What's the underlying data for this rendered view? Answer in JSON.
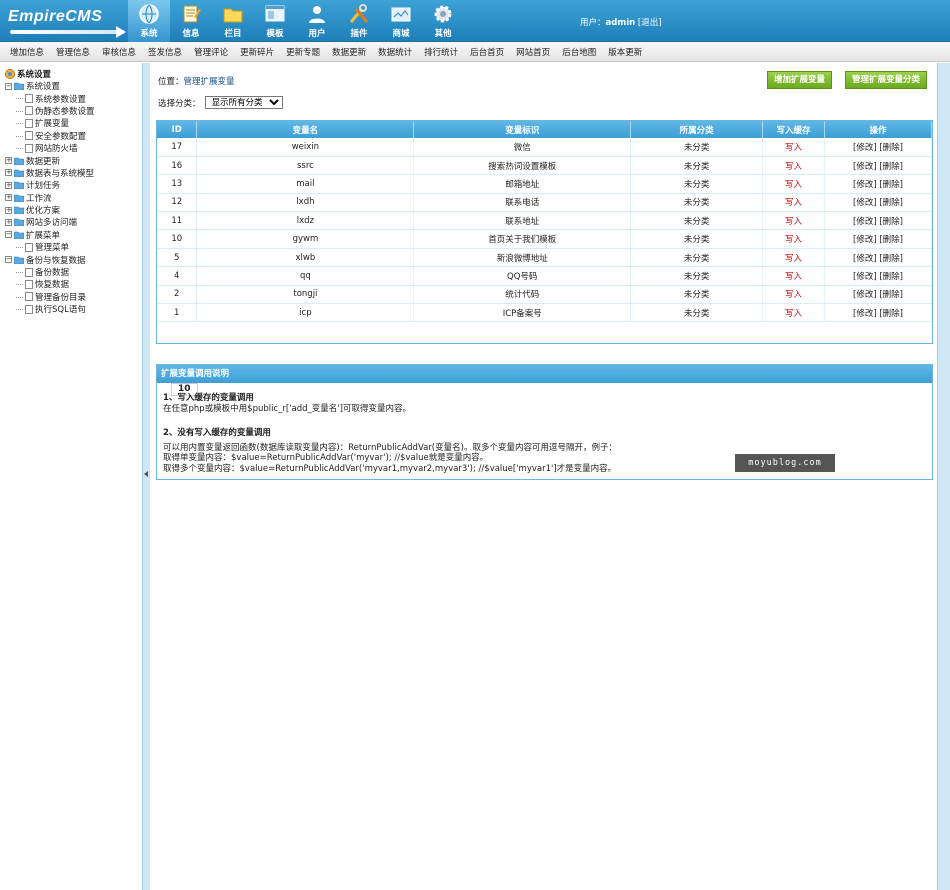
{
  "header": {
    "logo_text": "EmpireCMS",
    "modules": [
      {
        "label": "系统",
        "icon": "globe-icon",
        "active": true
      },
      {
        "label": "信息",
        "icon": "notepad-icon",
        "active": false
      },
      {
        "label": "栏目",
        "icon": "folder-icon",
        "active": false
      },
      {
        "label": "模板",
        "icon": "template-window-icon",
        "active": false
      },
      {
        "label": "用户",
        "icon": "user-icon",
        "active": false
      },
      {
        "label": "插件",
        "icon": "tools-icon",
        "active": false
      },
      {
        "label": "商城",
        "icon": "shop-icon",
        "active": false
      },
      {
        "label": "其他",
        "icon": "gear-icon",
        "active": false
      }
    ],
    "user_prefix": "用户：",
    "username": "admin",
    "logout": "[退出]"
  },
  "menubar": [
    "增加信息",
    "管理信息",
    "审核信息",
    "签发信息",
    "管理评论",
    "更新碎片",
    "更新专题",
    "数据更新",
    "数据统计",
    "排行统计",
    "后台首页",
    "网站首页",
    "后台地图",
    "版本更新"
  ],
  "tree": {
    "root": "系统设置",
    "nodes": [
      {
        "label": "系统设置",
        "type": "folder",
        "toggle": "−",
        "level": 0
      },
      {
        "label": "系统参数设置",
        "type": "page",
        "level": 1
      },
      {
        "label": "伪静态参数设置",
        "type": "page",
        "level": 1
      },
      {
        "label": "扩展变量",
        "type": "page",
        "level": 1
      },
      {
        "label": "安全参数配置",
        "type": "page",
        "level": 1
      },
      {
        "label": "网站防火墙",
        "type": "page",
        "level": 1
      },
      {
        "label": "数据更新",
        "type": "folder",
        "toggle": "+",
        "level": 0
      },
      {
        "label": "数据表与系统模型",
        "type": "folder",
        "toggle": "+",
        "level": 0
      },
      {
        "label": "计划任务",
        "type": "folder",
        "toggle": "+",
        "level": 0
      },
      {
        "label": "工作流",
        "type": "folder",
        "toggle": "+",
        "level": 0
      },
      {
        "label": "优化方案",
        "type": "folder",
        "toggle": "+",
        "level": 0
      },
      {
        "label": "网站多访问端",
        "type": "folder",
        "toggle": "+",
        "level": 0
      },
      {
        "label": "扩展菜单",
        "type": "folder",
        "toggle": "−",
        "level": 0
      },
      {
        "label": "管理菜单",
        "type": "page",
        "level": 1
      },
      {
        "label": "备份与恢复数据",
        "type": "folder",
        "toggle": "−",
        "level": 0
      },
      {
        "label": "备份数据",
        "type": "page",
        "level": 1
      },
      {
        "label": "恢复数据",
        "type": "page",
        "level": 1
      },
      {
        "label": "管理备份目录",
        "type": "page",
        "level": 1
      },
      {
        "label": "执行SQL语句",
        "type": "page",
        "level": 1
      }
    ]
  },
  "main": {
    "location_prefix": "位置：",
    "location_link": "管理扩展变量",
    "btn_add": "增加扩展变量",
    "btn_category": "管理扩展变量分类",
    "filter_label": "选择分类：",
    "filter_selected": "显示所有分类",
    "columns": [
      "ID",
      "变量名",
      "变量标识",
      "所属分类",
      "写入缓存",
      "操作"
    ],
    "rows": [
      {
        "id": "17",
        "name": "weixin",
        "label": "微信",
        "cat": "未分类",
        "cache": "写入",
        "ops": "[修改] [删除]"
      },
      {
        "id": "16",
        "name": "ssrc",
        "label": "搜索热词设置模板",
        "cat": "未分类",
        "cache": "写入",
        "ops": "[修改] [删除]"
      },
      {
        "id": "13",
        "name": "mail",
        "label": "邮箱地址",
        "cat": "未分类",
        "cache": "写入",
        "ops": "[修改] [删除]"
      },
      {
        "id": "12",
        "name": "lxdh",
        "label": "联系电话",
        "cat": "未分类",
        "cache": "写入",
        "ops": "[修改] [删除]"
      },
      {
        "id": "11",
        "name": "lxdz",
        "label": "联系地址",
        "cat": "未分类",
        "cache": "写入",
        "ops": "[修改] [删除]"
      },
      {
        "id": "10",
        "name": "gywm",
        "label": "首页关于我们模板",
        "cat": "未分类",
        "cache": "写入",
        "ops": "[修改] [删除]"
      },
      {
        "id": "5",
        "name": "xlwb",
        "label": "新浪微博地址",
        "cat": "未分类",
        "cache": "写入",
        "ops": "[修改] [删除]"
      },
      {
        "id": "4",
        "name": "qq",
        "label": "QQ号码",
        "cat": "未分类",
        "cache": "写入",
        "ops": "[修改] [删除]"
      },
      {
        "id": "2",
        "name": "tongji",
        "label": "统计代码",
        "cat": "未分类",
        "cache": "写入",
        "ops": "[修改] [删除]"
      },
      {
        "id": "1",
        "name": "icp",
        "label": "ICP备案号",
        "cat": "未分类",
        "cache": "写入",
        "ops": "[修改] [删除]"
      }
    ],
    "pager": "10",
    "explain": {
      "title": "扩展变量调用说明",
      "h1": "1、写入缓存的变量调用",
      "p1": "在任意php或模板中用$public_r['add_变量名']可取得变量内容。",
      "h2": "2、没有写入缓存的变量调用",
      "p2": "可以用内置变量返回函数(数据库读取变量内容)：ReturnPublicAddVar(变量名)。取多个变量内容可用逗号隔开，例子：",
      "p3": "取得单变量内容：$value=ReturnPublicAddVar('myvar'); //$value就是变量内容。",
      "p4": "取得多个变量内容：$value=ReturnPublicAddVar('myvar1,myvar2,myvar3'); //$value['myvar1']才是变量内容。"
    }
  },
  "watermark": "moyublog.com",
  "colors": {
    "header": "#2b8fc8",
    "table_head": "#4aaadb",
    "green_btn": "#7dbd33",
    "cache_red": "#cc0000"
  }
}
